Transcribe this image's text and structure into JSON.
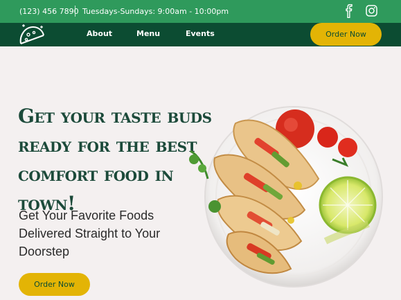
{
  "topbar": {
    "phone": "(123) 456 7890",
    "hours": "Tuesdays-Sundays: 9:00am - 10:00pm",
    "social_icons": [
      "facebook-icon",
      "instagram-icon"
    ]
  },
  "navbar": {
    "logo_icon": "taco-logo-icon",
    "links": [
      "About",
      "Menu",
      "Events"
    ],
    "order_label": "Order Now"
  },
  "hero": {
    "title": "Get your taste buds ready for the best comfort food in town!",
    "subtitle": "Get Your Favorite Foods Delivered Straight to Your Doorstep",
    "order_label": "Order Now",
    "image": "tacos-plate-image"
  },
  "colors": {
    "topbar": "#2f9a5c",
    "navbar": "#0c4c32",
    "accent": "#e3b405",
    "background": "#f4f0f0",
    "title": "#1c4a3a"
  }
}
